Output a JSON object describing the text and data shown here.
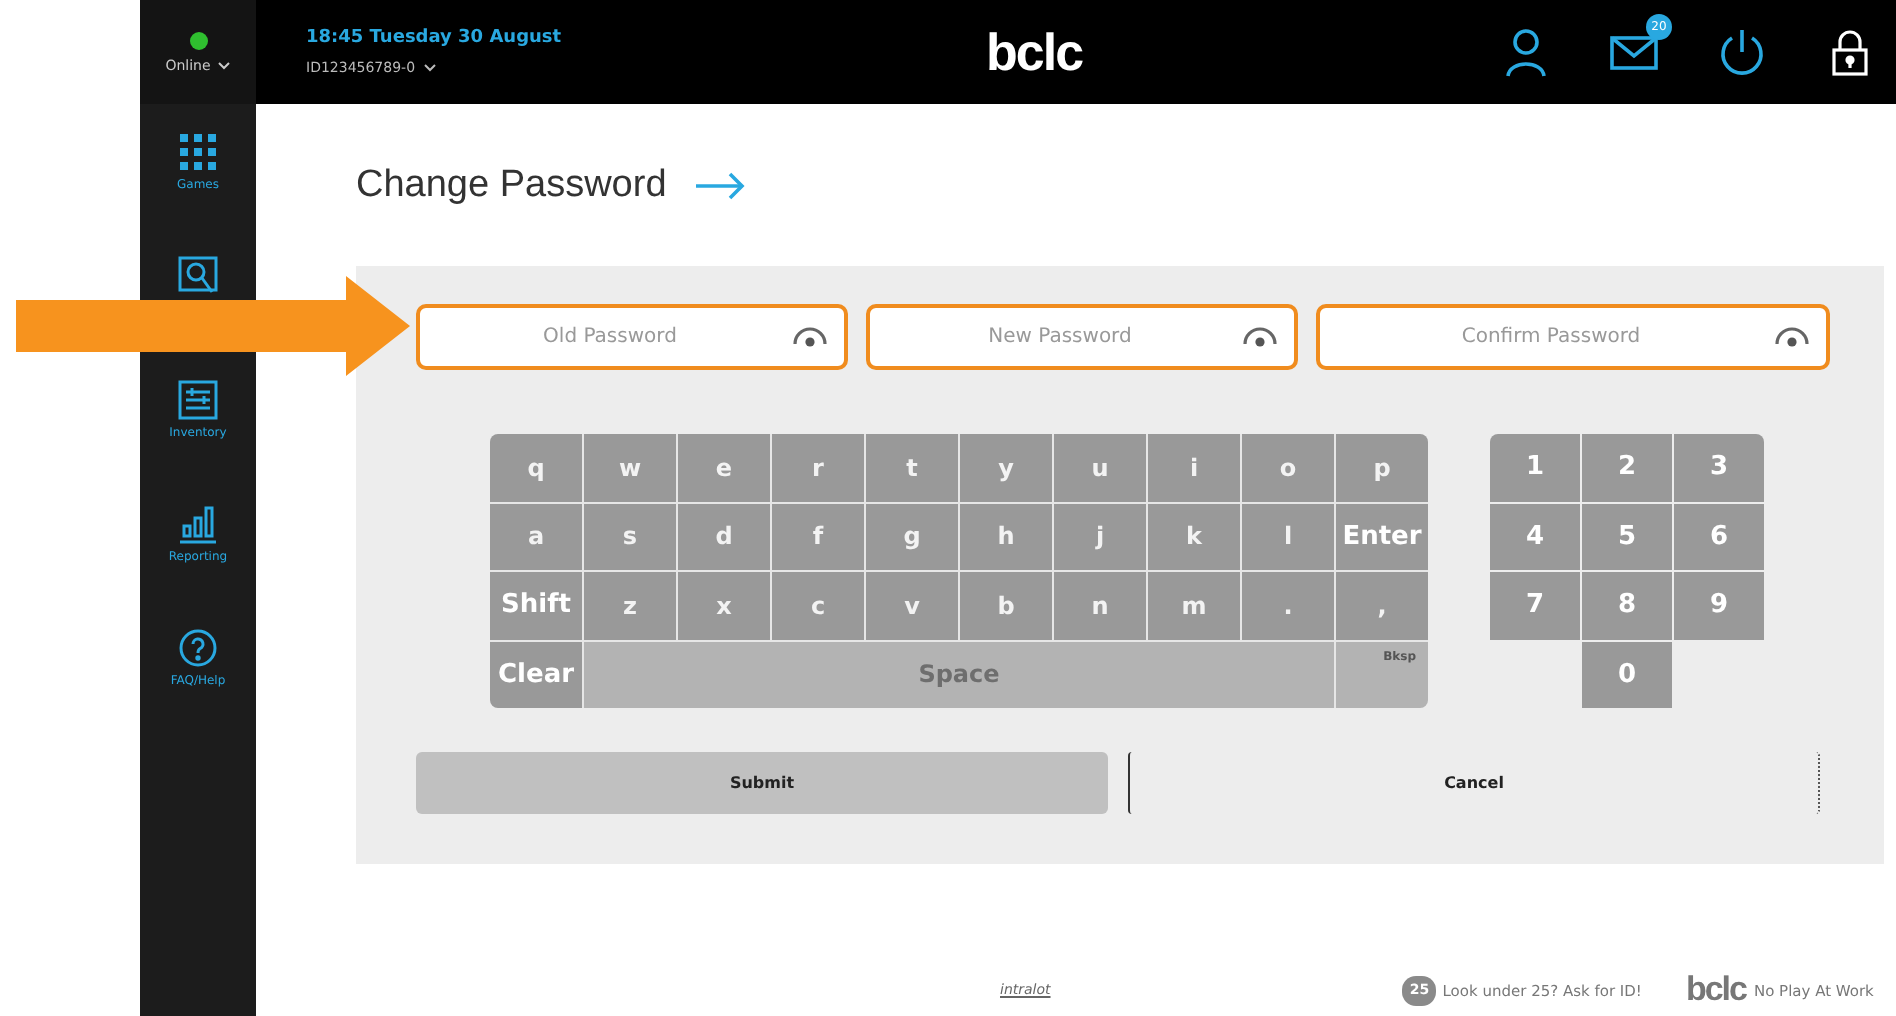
{
  "status": {
    "label": "Online",
    "online": true
  },
  "header": {
    "datetime": "18:45 Tuesday 30 August",
    "terminal": "ID123456789-0",
    "logo": "bclc",
    "mail_badge": "20"
  },
  "sidebar": {
    "items": [
      {
        "kind": "games",
        "label": "Games"
      },
      {
        "kind": "search"
      },
      {
        "kind": "inventory",
        "label": "Inventory"
      },
      {
        "kind": "reporting",
        "label": "Reporting"
      },
      {
        "kind": "help",
        "label": "FAQ/Help"
      }
    ]
  },
  "page_title": "Change Password",
  "fields": [
    {
      "placeholder": "Old Password"
    },
    {
      "placeholder": "New Password"
    },
    {
      "placeholder": "Confirm Password"
    }
  ],
  "keyboard": {
    "rows": [
      [
        {
          "label": "q"
        },
        {
          "label": "w"
        },
        {
          "label": "e"
        },
        {
          "label": "r"
        },
        {
          "label": "t"
        },
        {
          "label": "y"
        },
        {
          "label": "u"
        },
        {
          "label": "i"
        },
        {
          "label": "o"
        },
        {
          "label": "p"
        }
      ],
      [
        {
          "label": "a"
        },
        {
          "label": "s"
        },
        {
          "label": "d"
        },
        {
          "label": "f"
        },
        {
          "label": "g"
        },
        {
          "label": "h"
        },
        {
          "label": "j"
        },
        {
          "label": "k"
        },
        {
          "label": "l"
        },
        {
          "label": "Enter",
          "kind": "action"
        }
      ],
      [
        {
          "label": "Shift",
          "kind": "action"
        },
        {
          "label": "z"
        },
        {
          "label": "x"
        },
        {
          "label": "c"
        },
        {
          "label": "v"
        },
        {
          "label": "b"
        },
        {
          "label": "n"
        },
        {
          "label": "m"
        },
        {
          "label": "."
        },
        {
          "label": ","
        }
      ],
      [
        {
          "label": "Clear",
          "kind": "action"
        },
        {
          "label": "Space",
          "kind": "space"
        },
        {
          "label": "Bksp",
          "kind": "faint"
        }
      ]
    ]
  },
  "numpad": [
    {
      "label": "1"
    },
    {
      "label": "2"
    },
    {
      "label": "3"
    },
    {
      "label": "4"
    },
    {
      "label": "5"
    },
    {
      "label": "6"
    },
    {
      "label": "7"
    },
    {
      "label": "8"
    },
    {
      "label": "9"
    },
    {
      "label": "0"
    }
  ],
  "buttons": [
    {
      "label": "Submit",
      "kind": "primary"
    },
    {
      "label": "Cancel",
      "kind": "outline"
    }
  ],
  "footer": {
    "vendor": "intralot",
    "age_badge": "25",
    "age_notice": "Look under 25? Ask for ID!",
    "logo": "bclc",
    "slogan": "No Play At Work"
  }
}
